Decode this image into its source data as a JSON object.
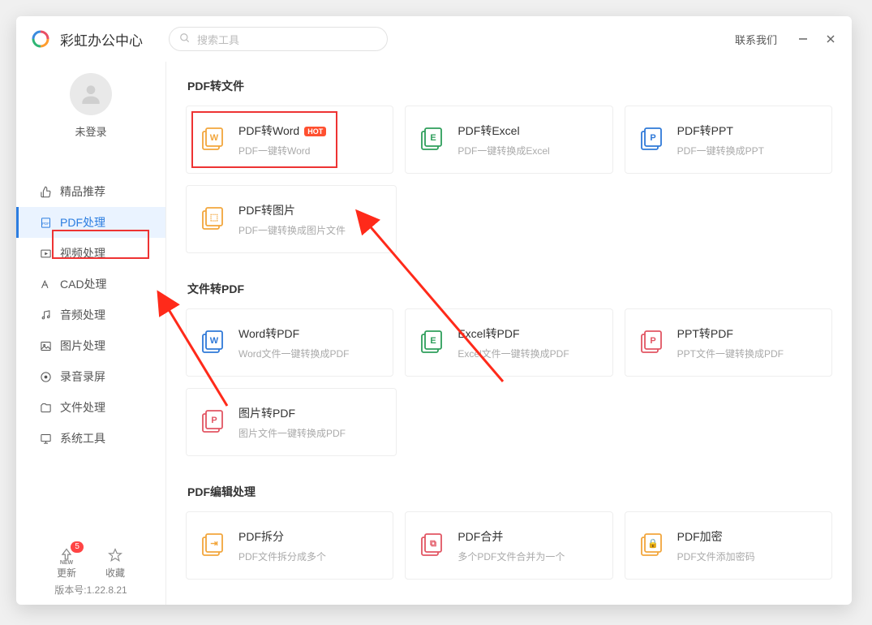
{
  "app": {
    "title": "彩虹办公中心",
    "search_placeholder": "搜索工具",
    "contact_label": "联系我们"
  },
  "user": {
    "login_status": "未登录"
  },
  "sidebar": {
    "items": [
      {
        "icon": "thumb-icon",
        "label": "精品推荐"
      },
      {
        "icon": "pdf-icon",
        "label": "PDF处理"
      },
      {
        "icon": "video-icon",
        "label": "视频处理"
      },
      {
        "icon": "cad-icon",
        "label": "CAD处理"
      },
      {
        "icon": "audio-icon",
        "label": "音频处理"
      },
      {
        "icon": "image-icon",
        "label": "图片处理"
      },
      {
        "icon": "record-icon",
        "label": "录音录屏"
      },
      {
        "icon": "file-icon",
        "label": "文件处理"
      },
      {
        "icon": "system-icon",
        "label": "系统工具"
      }
    ],
    "active_index": 1,
    "footer": {
      "update_label": "更新",
      "update_badge": "5",
      "favorite_label": "收藏",
      "version_label": "版本号:1.22.8.21"
    }
  },
  "sections": [
    {
      "title": "PDF转文件",
      "rows": [
        [
          {
            "icon": "#f2a63c",
            "glyph": "W",
            "title": "PDF转Word",
            "sub": "PDF一键转Word",
            "hot": true,
            "highlight": true
          },
          {
            "icon": "#2e9e5b",
            "glyph": "E",
            "title": "PDF转Excel",
            "sub": "PDF一键转换成Excel"
          },
          {
            "icon": "#2f79d8",
            "glyph": "P",
            "title": "PDF转PPT",
            "sub": "PDF一键转换成PPT"
          }
        ],
        [
          {
            "icon": "#f2a63c",
            "glyph": "⬚",
            "title": "PDF转图片",
            "sub": "PDF一键转换成图片文件"
          }
        ]
      ]
    },
    {
      "title": "文件转PDF",
      "rows": [
        [
          {
            "icon": "#2f79d8",
            "glyph": "W",
            "title": "Word转PDF",
            "sub": "Word文件一键转换成PDF"
          },
          {
            "icon": "#2e9e5b",
            "glyph": "E",
            "title": "Excel转PDF",
            "sub": "Excel文件一键转换成PDF"
          },
          {
            "icon": "#e25563",
            "glyph": "P",
            "title": "PPT转PDF",
            "sub": "PPT文件一键转换成PDF"
          }
        ],
        [
          {
            "icon": "#e25563",
            "glyph": "P",
            "title": "图片转PDF",
            "sub": "图片文件一键转换成PDF"
          }
        ]
      ]
    },
    {
      "title": "PDF编辑处理",
      "rows": [
        [
          {
            "icon": "#f2a63c",
            "glyph": "⇥",
            "title": "PDF拆分",
            "sub": "PDF文件拆分成多个"
          },
          {
            "icon": "#e25563",
            "glyph": "⧉",
            "title": "PDF合并",
            "sub": "多个PDF文件合并为一个"
          },
          {
            "icon": "#f2a63c",
            "glyph": "🔒",
            "title": "PDF加密",
            "sub": "PDF文件添加密码"
          }
        ]
      ]
    }
  ]
}
